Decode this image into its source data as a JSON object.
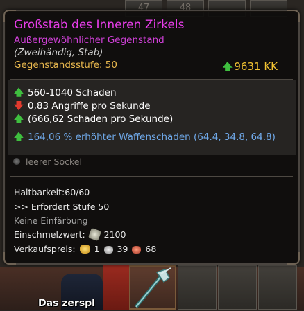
{
  "background": {
    "slot_numbers": [
      "47",
      "48"
    ],
    "bottom_text": "Das zerspl"
  },
  "tooltip": {
    "name": "Großstab des Inneren Zirkels",
    "rarity": "Außergewöhnlicher Gegenstand",
    "type": "(Zweihändig, Stab)",
    "level_label": "Gegenstandsstufe: 50",
    "score": "9631 KK",
    "stats": [
      {
        "direction": "up",
        "text": "560-1040 Schaden"
      },
      {
        "direction": "down",
        "text": "0,83 Angriffe pro Sekunde"
      },
      {
        "direction": "up",
        "text": "(666,62 Schaden pro Sekunde)"
      },
      {
        "direction": "up",
        "text": "164,06 % erhöhter Waffenschaden (64.4, 34.8, 64.8)"
      }
    ],
    "socket": "leerer Sockel",
    "durability": "Haltbarkeit:60/60",
    "requirement": ">> Erfordert Stufe 50",
    "dye": "Keine Einfärbung",
    "salvage_label": "Einschmelzwert:",
    "salvage_value": "2100",
    "sell_label": "Verkaufspreis:",
    "sell_gold": "1",
    "sell_silver": "39",
    "sell_copper": "68"
  },
  "colors": {
    "name": "#e63de8",
    "rarity": "#d040d8",
    "level": "#e9b84e",
    "score": "#f1c232",
    "up_arrow": "#3fbf3f",
    "down_arrow": "#e23a2e",
    "bonus_stat": "#6fa8e8"
  },
  "icons": {
    "up": "arrow-up-icon",
    "down": "arrow-down-icon",
    "socket": "empty-socket-icon",
    "salvage": "salvage-material-icon",
    "gold": "gold-coin-icon",
    "silver": "silver-coin-icon",
    "copper": "copper-coin-icon"
  }
}
